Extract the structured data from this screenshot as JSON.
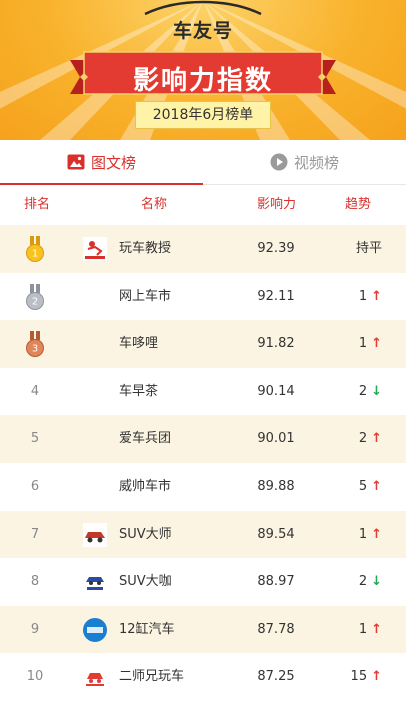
{
  "header": {
    "brand": "车友号",
    "title": "影响力指数",
    "subtitle": "2018年6月榜单"
  },
  "tabs": [
    {
      "label": "图文榜",
      "icon": "image-icon",
      "active": true
    },
    {
      "label": "视频榜",
      "icon": "play-icon",
      "active": false
    }
  ],
  "columns": {
    "rank": "排名",
    "name": "名称",
    "influence": "影响力",
    "trend": "趋势"
  },
  "rows": [
    {
      "rank": "1",
      "medal": "gold",
      "name": "玩车教授",
      "score": "92.39",
      "trend": "持平",
      "dir": "flat",
      "logo": "wanche-logo"
    },
    {
      "rank": "2",
      "medal": "silver",
      "name": "网上车市",
      "score": "92.11",
      "trend": "1",
      "dir": "up",
      "logo": ""
    },
    {
      "rank": "3",
      "medal": "bronze",
      "name": "车哆哩",
      "score": "91.82",
      "trend": "1",
      "dir": "up",
      "logo": ""
    },
    {
      "rank": "4",
      "name": "车早茶",
      "score": "90.14",
      "trend": "2",
      "dir": "down",
      "logo": ""
    },
    {
      "rank": "5",
      "name": "爱车兵团",
      "score": "90.01",
      "trend": "2",
      "dir": "up",
      "logo": ""
    },
    {
      "rank": "6",
      "name": "威帅车市",
      "score": "89.88",
      "trend": "5",
      "dir": "up",
      "logo": ""
    },
    {
      "rank": "7",
      "name": "SUV大师",
      "score": "89.54",
      "trend": "1",
      "dir": "up",
      "logo": "suv-dashi-logo"
    },
    {
      "rank": "8",
      "name": "SUV大咖",
      "score": "88.97",
      "trend": "2",
      "dir": "down",
      "logo": "suv-daka-logo"
    },
    {
      "rank": "9",
      "name": "12缸汽车",
      "score": "87.78",
      "trend": "1",
      "dir": "up",
      "logo": "12gang-logo"
    },
    {
      "rank": "10",
      "name": "二师兄玩车",
      "score": "87.25",
      "trend": "15",
      "dir": "up",
      "logo": "ershixiong-logo"
    }
  ],
  "colors": {
    "accent": "#d9302c",
    "up": "#e23b36",
    "down": "#2aa356",
    "row_alt": "#fbf4e2",
    "header_bg": "#f9b22c"
  }
}
